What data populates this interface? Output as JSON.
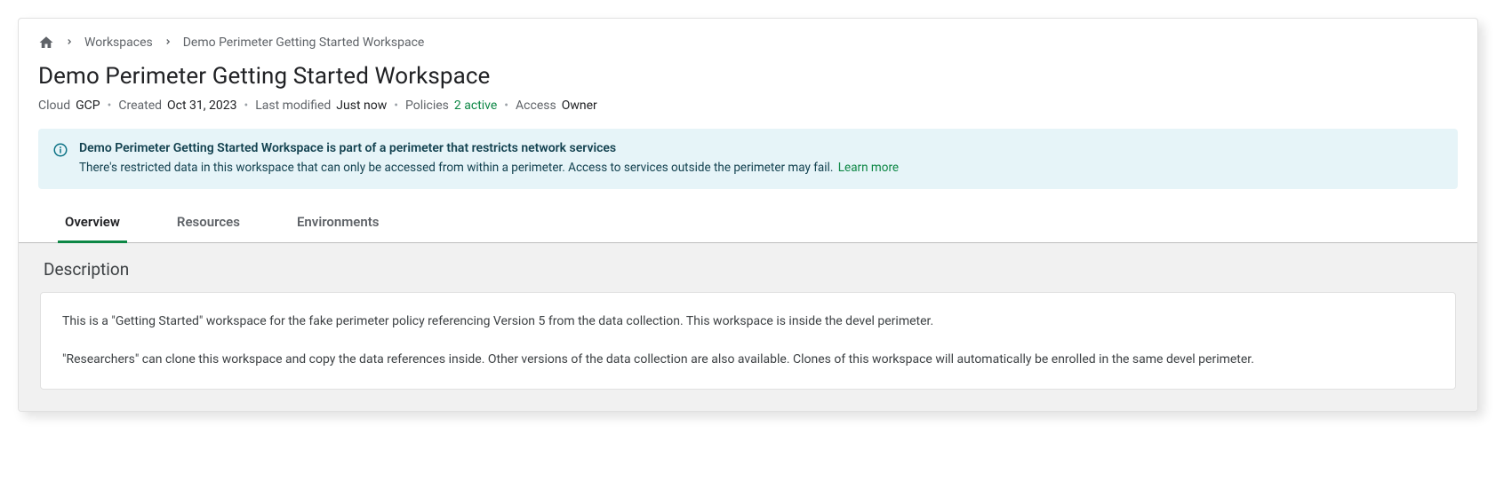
{
  "breadcrumb": {
    "workspaces": "Workspaces",
    "current": "Demo Perimeter Getting Started Workspace"
  },
  "page_title": "Demo Perimeter Getting Started Workspace",
  "meta": {
    "cloud_label": "Cloud",
    "cloud_value": "GCP",
    "created_label": "Created",
    "created_value": "Oct 31, 2023",
    "modified_label": "Last modified",
    "modified_value": "Just now",
    "policies_label": "Policies",
    "policies_value": "2 active",
    "access_label": "Access",
    "access_value": "Owner"
  },
  "alert": {
    "title": "Demo Perimeter Getting Started Workspace is part of a perimeter that restricts network services",
    "body": "There's restricted data in this workspace that can only be accessed from within a perimeter. Access to services outside the perimeter may fail.",
    "learn_more": "Learn more"
  },
  "tabs": {
    "overview": "Overview",
    "resources": "Resources",
    "environments": "Environments"
  },
  "description": {
    "heading": "Description",
    "para1": "This is a \"Getting Started\" workspace for the fake perimeter policy referencing Version 5 from the data collection. This workspace is inside the devel perimeter.",
    "para2": "\"Researchers\" can clone this workspace and copy the data references inside. Other versions of the data collection are also available. Clones of this workspace will automatically be enrolled in the same devel perimeter."
  }
}
